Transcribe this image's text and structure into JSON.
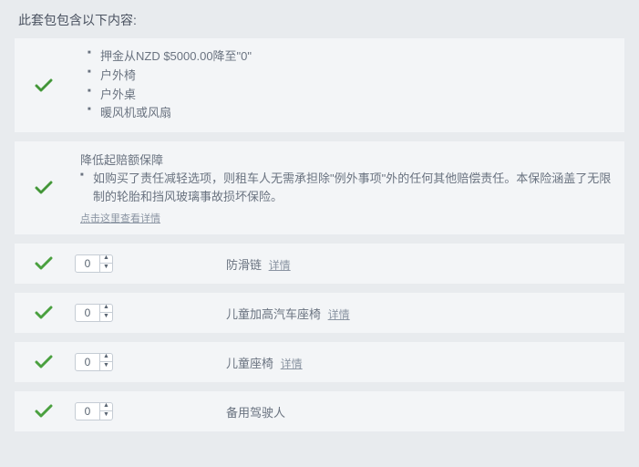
{
  "heading": "此套包包含以下内容:",
  "block1": {
    "items": [
      "押金从NZD $5000.00降至\"0\"",
      "户外椅",
      "户外桌",
      "暖风机或风扇"
    ]
  },
  "block2": {
    "subtitle": "降低起赔额保障",
    "desc": "如购买了责任减轻选项，则租车人无需承担除\"例外事项\"外的任何其他赔偿责任。本保险涵盖了无限制的轮胎和挡风玻璃事故损坏保险。",
    "details_link": "点击这里查看详情"
  },
  "options": [
    {
      "value": "0",
      "label": "防滑链",
      "details": "详情"
    },
    {
      "value": "0",
      "label": "儿童加高汽车座椅",
      "details": "详情"
    },
    {
      "value": "0",
      "label": "儿童座椅",
      "details": "详情"
    },
    {
      "value": "0",
      "label": "备用驾驶人",
      "details": ""
    }
  ]
}
